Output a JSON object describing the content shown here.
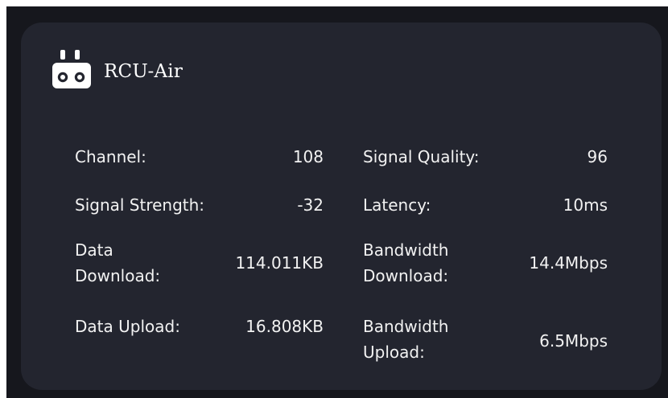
{
  "device": {
    "name": "RCU-Air",
    "icon": "remote-controller-icon"
  },
  "stats": [
    {
      "left": {
        "label": "Channel:",
        "value": "108"
      },
      "right": {
        "label": "Signal Quality:",
        "value": "96"
      }
    },
    {
      "left": {
        "label": "Signal Strength:",
        "value": "-32"
      },
      "right": {
        "label": "Latency:",
        "value": "10ms"
      }
    },
    {
      "left": {
        "label": "Data\nDownload:",
        "value": "114.011KB"
      },
      "right": {
        "label": "Bandwidth\nDownload:",
        "value": "14.4Mbps"
      }
    },
    {
      "left": {
        "label": "Data Upload:",
        "value": "16.808KB"
      },
      "right": {
        "label": "Bandwidth\nUpload:",
        "value": "6.5Mbps"
      }
    }
  ],
  "colors": {
    "frame_bg": "#16171d",
    "card_bg": "#23252f",
    "text": "#f2f2f2"
  }
}
